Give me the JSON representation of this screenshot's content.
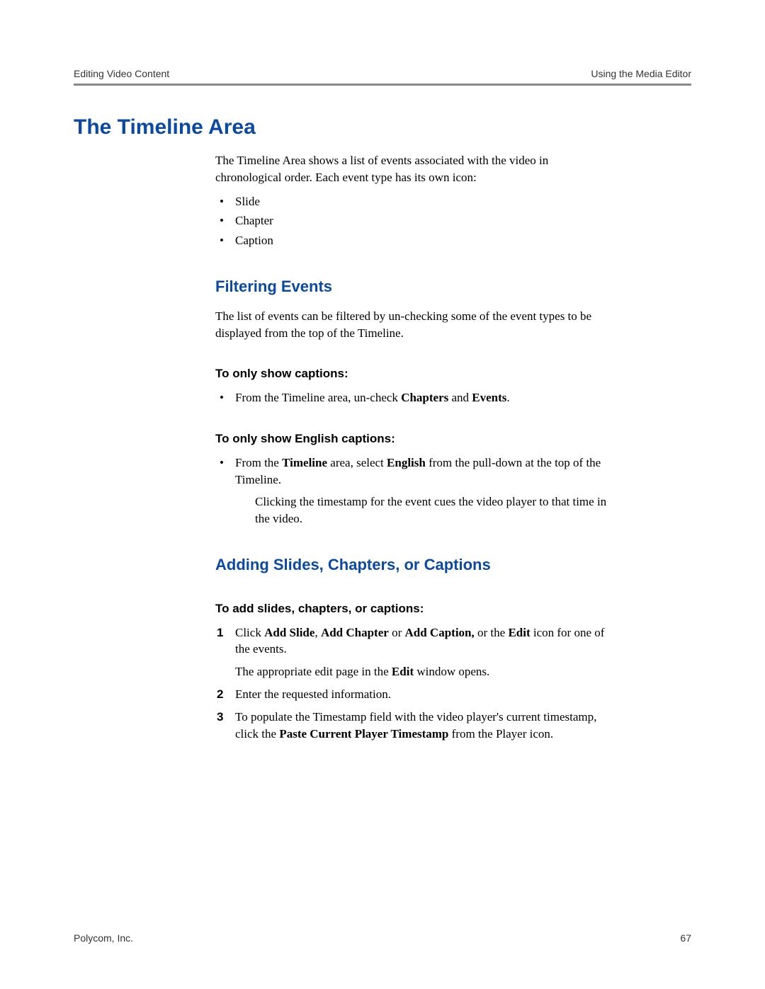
{
  "header": {
    "left": "Editing Video Content",
    "right": "Using the Media Editor"
  },
  "h1": "The Timeline Area",
  "intro": "The Timeline Area shows a list of events associated with the video in chronological order. Each event type has its own icon:",
  "event_types": [
    "Slide",
    "Chapter",
    "Caption"
  ],
  "filtering": {
    "title": "Filtering Events",
    "intro": "The list of events can be filtered by un-checking some of the event types to be displayed from the top of the Timeline.",
    "captions_only": {
      "title": "To only show captions:",
      "item_pre": "From the Timeline area, un-check ",
      "b1": "Chapters",
      "mid": " and ",
      "b2": "Events",
      "post": "."
    },
    "english_only": {
      "title": "To only show English captions:",
      "item_pre": "From the ",
      "b1": "Timeline",
      "mid1": " area, select ",
      "b2": "English",
      "post": " from the pull-down at the top of the Timeline.",
      "followup": "Clicking the timestamp for the event cues the video player to that time in the video."
    }
  },
  "adding": {
    "title": "Adding Slides, Chapters, or Captions",
    "howto_title": "To add slides, chapters, or captions:",
    "step1": {
      "pre": "Click ",
      "b1": "Add Slide",
      "c1": ", ",
      "b2": "Add Chapter",
      "c2": " or ",
      "b3": "Add Caption,",
      "c3": " or the ",
      "b4": "Edit",
      "post": " icon for one of the events.",
      "follow_pre": "The appropriate edit page in the ",
      "follow_b": "Edit",
      "follow_post": " window opens."
    },
    "step2": "Enter the requested information.",
    "step3": {
      "pre": "To populate the Timestamp field with the video player's current timestamp, click the ",
      "b1": "Paste Current Player Timestamp",
      "post": " from the Player icon."
    }
  },
  "footer": {
    "left": "Polycom, Inc.",
    "right": "67"
  }
}
